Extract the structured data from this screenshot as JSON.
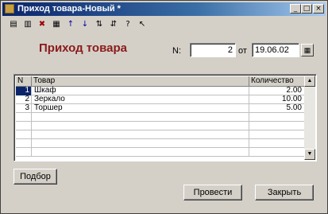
{
  "window": {
    "title": "Приход товара-Новый *"
  },
  "header": {
    "doc_title": "Приход товара",
    "number_label": "N:",
    "number_value": "2",
    "date_label": "от",
    "date_value": "19.06.02"
  },
  "table": {
    "columns": [
      "N",
      "Товар",
      "Количество"
    ],
    "rows": [
      {
        "n": "1",
        "product": "Шкаф",
        "qty": "2.00"
      },
      {
        "n": "2",
        "product": "Зеркало",
        "qty": "10.00"
      },
      {
        "n": "3",
        "product": "Торшер",
        "qty": "5.00"
      }
    ]
  },
  "buttons": {
    "select": "Подбор",
    "post": "Провести",
    "close": "Закрыть"
  }
}
